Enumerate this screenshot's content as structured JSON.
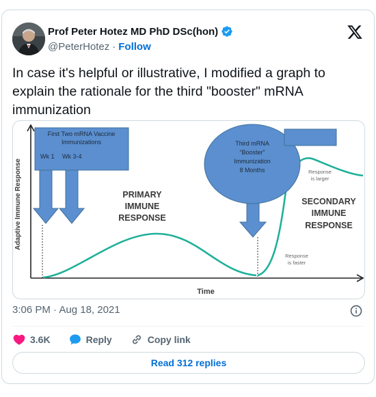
{
  "author": {
    "name": "Prof Peter Hotez MD PhD DSc(hon)",
    "handle": "@PeterHotez",
    "separator": "·",
    "follow_label": "Follow"
  },
  "tweet": {
    "text": "In case it's helpful or illustrative, I modified a graph to explain the rationale for the third \"booster\" mRNA immunization",
    "timestamp": "3:06 PM · Aug 18, 2021"
  },
  "actions": {
    "likes_count": "3.6K",
    "reply_label": "Reply",
    "copy_link_label": "Copy link",
    "read_replies_label": "Read 312 replies"
  },
  "graph": {
    "box1_line1": "First Two mRNA Vaccine",
    "box1_line2": "Immunizations",
    "box1_wk1": "Wk 1",
    "box1_wk2": "Wk 3-4",
    "circle_line1": "Third mRNA",
    "circle_line2": "“Booster”",
    "circle_line3": "Immunization",
    "circle_line4": "8 Months",
    "primary_line1": "PRIMARY",
    "primary_line2": "IMMUNE",
    "primary_line3": "RESPONSE",
    "secondary_line1": "SECONDARY",
    "secondary_line2": "IMMUNE",
    "secondary_line3": "RESPONSE",
    "larger_line1": "Response",
    "larger_line2": "is larger",
    "faster_line1": "Response",
    "faster_line2": "is faster",
    "ylabel": "Adaptive Immune Response",
    "xlabel": "Time",
    "colors": {
      "blue": "#5b8fcf",
      "blue_dark": "#41719c",
      "teal": "#1fb09a",
      "text": "#3a3a3a"
    }
  }
}
